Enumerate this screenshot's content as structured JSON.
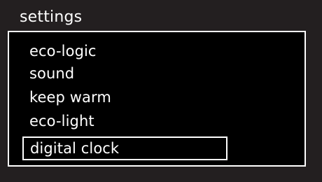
{
  "title": "settings",
  "menu": {
    "items": [
      {
        "label": "eco-logic",
        "selected": false
      },
      {
        "label": "sound",
        "selected": false
      },
      {
        "label": "keep warm",
        "selected": false
      },
      {
        "label": "eco-light",
        "selected": false
      },
      {
        "label": "digital clock",
        "selected": true
      }
    ]
  },
  "colors": {
    "background": "#231f20",
    "panel": "#000000",
    "text": "#ffffff",
    "border": "#ffffff"
  }
}
